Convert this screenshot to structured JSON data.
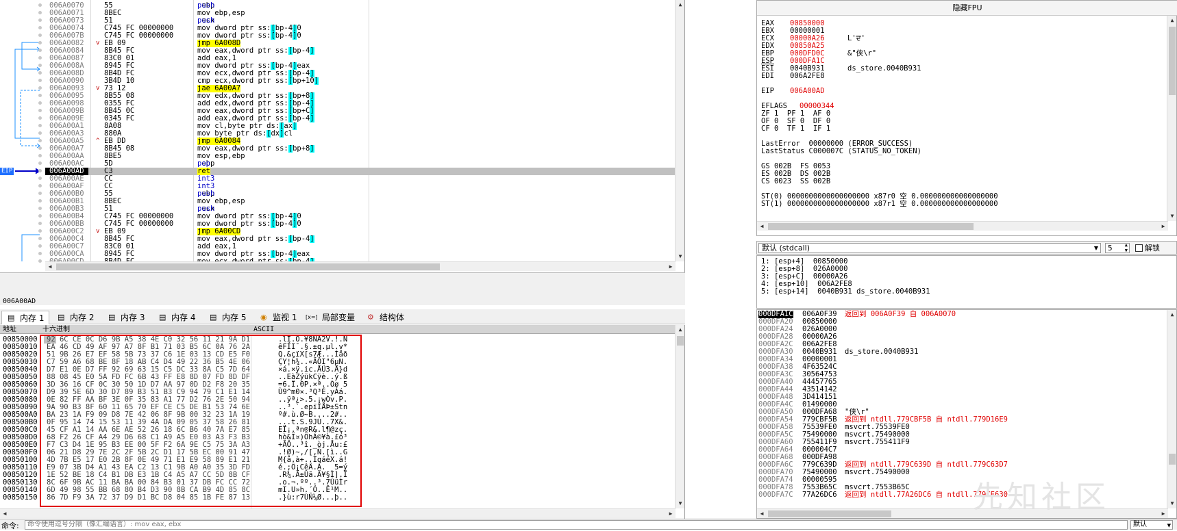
{
  "disasm": {
    "eip_label": "EIP",
    "rows": [
      {
        "addr": "006A0070",
        "arrow": "",
        "bytes": "55",
        "asm": "push ebp"
      },
      {
        "addr": "006A0071",
        "arrow": "",
        "bytes": "8BEC",
        "asm": "mov ebp,esp"
      },
      {
        "addr": "006A0073",
        "arrow": "",
        "bytes": "51",
        "asm": "push ecx"
      },
      {
        "addr": "006A0074",
        "arrow": "",
        "bytes": "C745 FC 00000000",
        "asm": "mov dword ptr ss:[ebp-4],0"
      },
      {
        "addr": "006A007B",
        "arrow": "",
        "bytes": "C745 FC 00000000",
        "asm": "mov dword ptr ss:[ebp-4],0"
      },
      {
        "addr": "006A0082",
        "arrow": "v",
        "bytes": "EB 09",
        "asm": "jmp 6A008D"
      },
      {
        "addr": "006A0084",
        "arrow": "",
        "bytes": "8B45 FC",
        "asm": "mov eax,dword ptr ss:[ebp-4]"
      },
      {
        "addr": "006A0087",
        "arrow": "",
        "bytes": "83C0 01",
        "asm": "add eax,1"
      },
      {
        "addr": "006A008A",
        "arrow": "",
        "bytes": "8945 FC",
        "asm": "mov dword ptr ss:[ebp-4],eax"
      },
      {
        "addr": "006A008D",
        "arrow": "",
        "bytes": "8B4D FC",
        "asm": "mov ecx,dword ptr ss:[ebp-4]"
      },
      {
        "addr": "006A0090",
        "arrow": "",
        "bytes": "3B4D 10",
        "asm": "cmp ecx,dword ptr ss:[ebp+10]"
      },
      {
        "addr": "006A0093",
        "arrow": "v",
        "bytes": "73 12",
        "asm": "jae 6A00A7"
      },
      {
        "addr": "006A0095",
        "arrow": "",
        "bytes": "8B55 08",
        "asm": "mov edx,dword ptr ss:[ebp+8]"
      },
      {
        "addr": "006A0098",
        "arrow": "",
        "bytes": "0355 FC",
        "asm": "add edx,dword ptr ss:[ebp-4]"
      },
      {
        "addr": "006A009B",
        "arrow": "",
        "bytes": "8B45 0C",
        "asm": "mov eax,dword ptr ss:[ebp+C]"
      },
      {
        "addr": "006A009E",
        "arrow": "",
        "bytes": "0345 FC",
        "asm": "add eax,dword ptr ss:[ebp-4]"
      },
      {
        "addr": "006A00A1",
        "arrow": "",
        "bytes": "8A08",
        "asm": "mov cl,byte ptr ds:[eax]"
      },
      {
        "addr": "006A00A3",
        "arrow": "",
        "bytes": "880A",
        "asm": "mov byte ptr ds:[edx],cl"
      },
      {
        "addr": "006A00A5",
        "arrow": "^",
        "bytes": "EB DD",
        "asm": "jmp 6A0084"
      },
      {
        "addr": "006A00A7",
        "arrow": "",
        "bytes": "8B45 08",
        "asm": "mov eax,dword ptr ss:[ebp+8]"
      },
      {
        "addr": "006A00AA",
        "arrow": "",
        "bytes": "8BE5",
        "asm": "mov esp,ebp"
      },
      {
        "addr": "006A00AC",
        "arrow": "",
        "bytes": "5D",
        "asm": "pop ebp"
      },
      {
        "addr": "006A00AD",
        "arrow": "",
        "bytes": "C3",
        "asm": "ret",
        "current": true
      },
      {
        "addr": "006A00AE",
        "arrow": "",
        "bytes": "CC",
        "asm": "int3"
      },
      {
        "addr": "006A00AF",
        "arrow": "",
        "bytes": "CC",
        "asm": "int3"
      },
      {
        "addr": "006A00B0",
        "arrow": "",
        "bytes": "55",
        "asm": "push ebp"
      },
      {
        "addr": "006A00B1",
        "arrow": "",
        "bytes": "8BEC",
        "asm": "mov ebp,esp"
      },
      {
        "addr": "006A00B3",
        "arrow": "",
        "bytes": "51",
        "asm": "push ecx"
      },
      {
        "addr": "006A00B4",
        "arrow": "",
        "bytes": "C745 FC 00000000",
        "asm": "mov dword ptr ss:[ebp-4],0"
      },
      {
        "addr": "006A00BB",
        "arrow": "",
        "bytes": "C745 FC 00000000",
        "asm": "mov dword ptr ss:[ebp-4],0"
      },
      {
        "addr": "006A00C2",
        "arrow": "v",
        "bytes": "EB 09",
        "asm": "jmp 6A00CD"
      },
      {
        "addr": "006A00C4",
        "arrow": "",
        "bytes": "8B45 FC",
        "asm": "mov eax,dword ptr ss:[ebp-4]"
      },
      {
        "addr": "006A00C7",
        "arrow": "",
        "bytes": "83C0 01",
        "asm": "add eax,1"
      },
      {
        "addr": "006A00CA",
        "arrow": "",
        "bytes": "8945 FC",
        "asm": "mov dword ptr ss:[ebp-4],eax"
      },
      {
        "addr": "006A00CD",
        "arrow": "",
        "bytes": "8B4D FC",
        "asm": "mov ecx,dword ptr ss:[ebp-4]"
      }
    ]
  },
  "status_line": "006A00AD",
  "tabs": [
    {
      "label": "内存 1",
      "icon": "memory-icon",
      "active": true
    },
    {
      "label": "内存 2",
      "icon": "memory-icon"
    },
    {
      "label": "内存 3",
      "icon": "memory-icon"
    },
    {
      "label": "内存 4",
      "icon": "memory-icon"
    },
    {
      "label": "内存 5",
      "icon": "memory-icon"
    },
    {
      "label": "监视 1",
      "icon": "watch-icon"
    },
    {
      "label": "局部变量",
      "icon": "locals-icon",
      "prefix": "[x=]"
    },
    {
      "label": "结构体",
      "icon": "struct-icon"
    }
  ],
  "dump": {
    "headers": {
      "addr": "地址",
      "hex": "十六进制",
      "ascii": "ASCII"
    },
    "rows": [
      {
        "addr": "00850000",
        "hex": "92 6C CE 0C D6 9B A5 38 4E C0 32 56 11 21 9A D1",
        "ascii": ".lÎ.Ö.¥8NÀ2V.!.Ñ"
      },
      {
        "addr": "00850010",
        "hex": "EA 46 CD 49 AF 97 A7 8F B1 71 03 B5 6C 0A 76 2A",
        "ascii": "êFÍI¯.§.±q.µl.v*"
      },
      {
        "addr": "00850020",
        "hex": "51 9B 26 E7 EF 58 5B 73 37 C6 1E 03 13 CD E5 F0",
        "ascii": "Q.&çïX[s7Æ...Íåð"
      },
      {
        "addr": "00850030",
        "hex": "C7 59 A6 68 BE 8F 18 AB C4 D4 49 22 36 B5 4E 06",
        "ascii": "ÇY¦h¾..«ÄÔI\"6µN."
      },
      {
        "addr": "00850040",
        "hex": "D7 E1 0E D7 FF 92 69 63 15 C5 DC 33 8A C5 7D 64",
        "ascii": "×á.×ÿ.ic.ÅÜ3.Å}d"
      },
      {
        "addr": "00850050",
        "hex": "88 08 45 E0 5A FD FC 6B 43 FF E8 8D 07 FD 8D DF",
        "ascii": "..EàZýükCÿè..ý.ß"
      },
      {
        "addr": "00850060",
        "hex": "3D 36 16 CF 0C 30 50 1D D7 AA 97 0D D2 F8 20 35",
        "ascii": "=6.Ï.0P.×ª..Òø 5"
      },
      {
        "addr": "00850070",
        "hex": "D9 39 5E 6D 30 D7 89 B3 51 B3 C9 94 79 C1 E1 14",
        "ascii": "Ù9^m0×.³Q³É.yÁá."
      },
      {
        "addr": "00850080",
        "hex": "0E 82 FF AA BF 3E 0F 35 83 A1 77 D2 76 2E 50 94",
        "ascii": "..ÿª¿>.5.¡wÒv.P."
      },
      {
        "addr": "00850090",
        "hex": "9A 90 B3 8F 60 11 65 70 EF CE C5 DE B1 53 74 6E",
        "ascii": "..³.`.epïÎÅÞ±Stn"
      },
      {
        "addr": "008500A0",
        "hex": "BA 23 1A F9 09 D8 7E 42 06 8F 9B 00 32 23 1A 19",
        "ascii": "º#.ù.Ø~B....2#.."
      },
      {
        "addr": "008500B0",
        "hex": "0F 95 14 74 15 53 11 39 4A DA 09 05 37 58 26 81",
        "ascii": "...t.S.9JÚ..7X&."
      },
      {
        "addr": "008500C0",
        "hex": "45 CF A1 14 AA 6E AE 52 26 18 6C B6 40 7A E7 85",
        "ascii": "EÏ¡.ªn®R&.l¶@zç."
      },
      {
        "addr": "008500D0",
        "hex": "68 F2 26 CF A4 29 D6 68 C1 A9 A5 E0 03 A3 F3 B3",
        "ascii": "hò&Ï¤)ÖhÁ©¥à.£ó³"
      },
      {
        "addr": "008500E0",
        "hex": "F7 C3 D4 1E 95 B3 EE 00 5F F2 6A 9E C5 75 3A A3",
        "ascii": "÷ÃÔ..³î._òj.Åu:£"
      },
      {
        "addr": "008500F0",
        "hex": "06 21 D8 29 7E 2C 2F 5B 2C D1 17 5B EC 00 91 47",
        "ascii": ".!Ø)~,/[,Ñ.[ì..G"
      },
      {
        "addr": "00850100",
        "hex": "4D 7B E5 17 E0 2B 8F 0E 49 71 E1 E9 58 89 E1 21",
        "ascii": "M{å.à+..IqáéX.á!"
      },
      {
        "addr": "00850110",
        "hex": "E9 07 3B D4 A1 43 EA C2 13 C1 9B A0 A0 35 3D FD",
        "ascii": "é.;Ô¡CêÂ.Á.  5=ý"
      },
      {
        "addr": "00850120",
        "hex": "1E 52 BE 18 C4 B1 DB E3 1B C4 A5 A7 CC 5D 8B CF",
        "ascii": ".R¾.Ä±Ûã.Ä¥§Ì].Ï"
      },
      {
        "addr": "00850130",
        "hex": "8C 6F 9B AC 11 BA BA 00 84 B3 01 37 DB FC CC 72",
        "ascii": ".o.¬.ºº..³.7ÛüÌr"
      },
      {
        "addr": "00850140",
        "hex": "6D 49 98 55 BB 68 80 B4 D3 90 8B CA B9 4D 85 8C",
        "ascii": "mI.U»h.´Ó..Ê¹M.."
      },
      {
        "addr": "00850150",
        "hex": "86 7D F9 3A 72 37 D9 D1 BC D8 04 85 1B FE 87 13",
        "ascii": ".}ù:r7ÙÑ¼Ø...þ.."
      }
    ]
  },
  "registers": {
    "title": "隐藏FPU",
    "gpr": [
      {
        "name": "EAX",
        "value": "00850000",
        "changed": true,
        "comment": ""
      },
      {
        "name": "EBX",
        "value": "00000001",
        "changed": false,
        "comment": ""
      },
      {
        "name": "ECX",
        "value": "00000A26",
        "changed": true,
        "comment": "L'ਦ'"
      },
      {
        "name": "EDX",
        "value": "00850A25",
        "changed": true,
        "comment": ""
      },
      {
        "name": "EBP",
        "value": "000DFD0C",
        "changed": true,
        "comment": "&\"侠\\r\""
      },
      {
        "name": "ESP",
        "value": "000DFA1C",
        "changed": true,
        "comment": ""
      },
      {
        "name": "ESI",
        "value": "0040B931",
        "changed": false,
        "comment": "ds_store.0040B931"
      },
      {
        "name": "EDI",
        "value": "006A2FE8",
        "changed": false,
        "comment": ""
      }
    ],
    "eip": {
      "name": "EIP",
      "value": "006A00AD"
    },
    "eflags": {
      "name": "EFLAGS",
      "value": "00000344"
    },
    "flags_lines": [
      "ZF 1  PF 1  AF 0",
      "OF 0  SF 0  DF 0",
      "CF 0  TF 1  IF 1"
    ],
    "last_error": "LastError  00000000 (ERROR_SUCCESS)",
    "last_status": "LastStatus C000007C (STATUS_NO_TOKEN)",
    "segs": [
      "GS 002B  FS 0053",
      "ES 002B  DS 002B",
      "CS 0023  SS 002B"
    ],
    "fpu": [
      "ST(0) 0000000000000000000 x87r0 空 0.000000000000000000",
      "ST(1) 0000000000000000000 x87r1 空 0.000000000000000000"
    ]
  },
  "callconv": {
    "label": "默认 (stdcall)",
    "count": "5",
    "unlock_label": "解锁"
  },
  "args": [
    "1: [esp+4]  00850000",
    "2: [esp+8]  026A0000",
    "3: [esp+C]  00000A26",
    "4: [esp+10]  006A2FE8",
    "5: [esp+14]  0040B931 ds_store.0040B931"
  ],
  "stack": [
    {
      "addr": "000DFA1C",
      "val": "006A0F39",
      "comment": "返回到 006A0F39 自 006A0070",
      "red": true,
      "top": true
    },
    {
      "addr": "000DFA20",
      "val": "00850000",
      "comment": ""
    },
    {
      "addr": "000DFA24",
      "val": "026A0000",
      "comment": ""
    },
    {
      "addr": "000DFA28",
      "val": "00000A26",
      "comment": ""
    },
    {
      "addr": "000DFA2C",
      "val": "006A2FE8",
      "comment": ""
    },
    {
      "addr": "000DFA30",
      "val": "0040B931",
      "comment": "ds_store.0040B931"
    },
    {
      "addr": "000DFA34",
      "val": "00000001",
      "comment": ""
    },
    {
      "addr": "000DFA38",
      "val": "4F63524C",
      "comment": ""
    },
    {
      "addr": "000DFA3C",
      "val": "30564753",
      "comment": ""
    },
    {
      "addr": "000DFA40",
      "val": "44457765",
      "comment": ""
    },
    {
      "addr": "000DFA44",
      "val": "43514142",
      "comment": ""
    },
    {
      "addr": "000DFA48",
      "val": "3D414151",
      "comment": ""
    },
    {
      "addr": "000DFA4C",
      "val": "01490000",
      "comment": ""
    },
    {
      "addr": "000DFA50",
      "val": "000DFA68",
      "comment": "\"侠\\r\""
    },
    {
      "addr": "000DFA54",
      "val": "779CBF5B",
      "comment": "返回到 ntdll.779CBF5B 自 ntdll.779D16E9",
      "red": true
    },
    {
      "addr": "000DFA58",
      "val": "75539FE0",
      "comment": "msvcrt.75539FE0"
    },
    {
      "addr": "000DFA5C",
      "val": "75490000",
      "comment": "msvcrt.75490000"
    },
    {
      "addr": "000DFA60",
      "val": "755411F9",
      "comment": "msvcrt.755411F9"
    },
    {
      "addr": "000DFA64",
      "val": "000004C7",
      "comment": ""
    },
    {
      "addr": "000DFA68",
      "val": "000DFA98",
      "comment": ""
    },
    {
      "addr": "000DFA6C",
      "val": "779C639D",
      "comment": "返回到 ntdll.779C639D 自 ntdll.779C63D7",
      "red": true
    },
    {
      "addr": "000DFA70",
      "val": "75490000",
      "comment": "msvcrt.75490000"
    },
    {
      "addr": "000DFA74",
      "val": "00000595",
      "comment": ""
    },
    {
      "addr": "000DFA78",
      "val": "7553B65C",
      "comment": "msvcrt.7553B65C"
    },
    {
      "addr": "000DFA7C",
      "val": "77A26DC6",
      "comment": "返回到 ntdll.77A26DC6 自 ntdll.779CE630",
      "red": true
    }
  ],
  "command": {
    "label": "命令:",
    "placeholder": "命令使用逗号分隔（像汇编语言）: mov eax, ebx",
    "mode": "默认"
  }
}
